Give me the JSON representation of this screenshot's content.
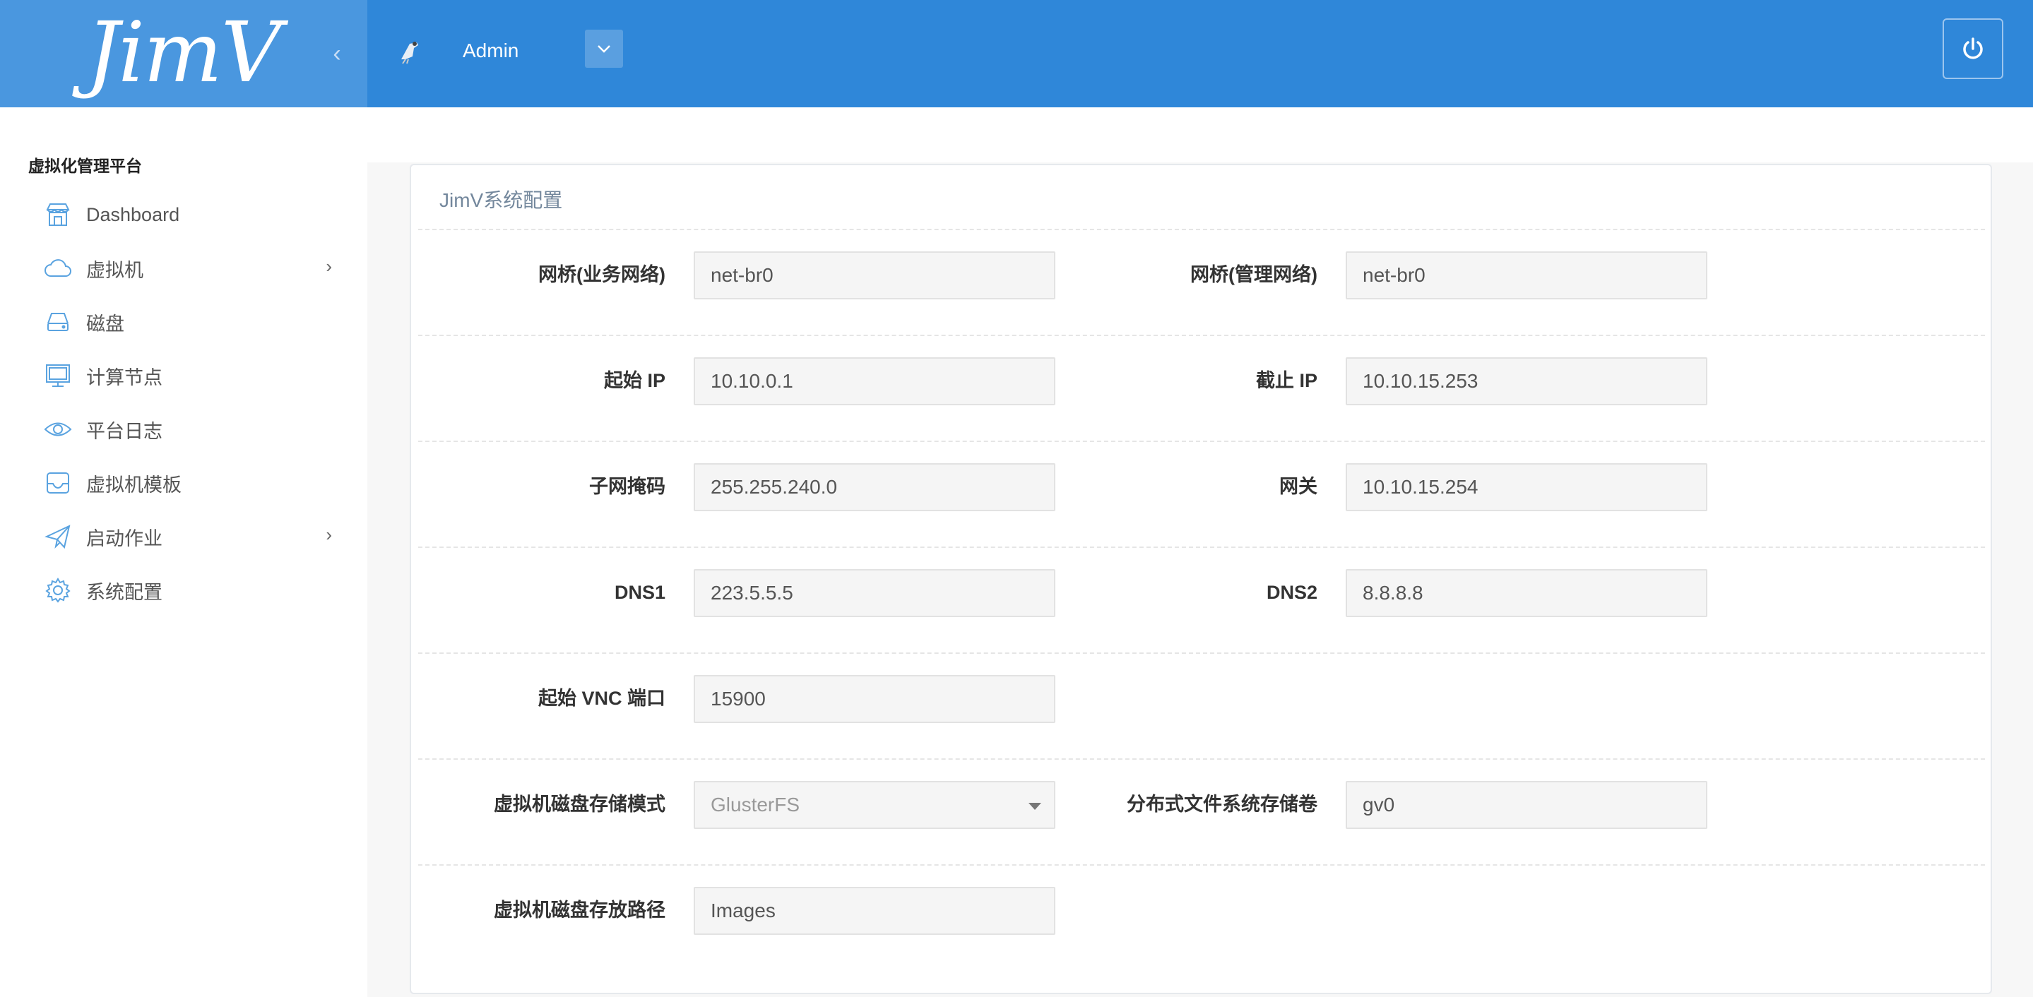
{
  "header": {
    "logo_text": "JimV",
    "user_name": "Admin",
    "collapse_icon": "chevron-left-icon",
    "dropdown_icon": "chevron-down-icon",
    "power_icon": "power-icon"
  },
  "sidebar": {
    "section_title": "虚拟化管理平台",
    "items": [
      {
        "label": "Dashboard",
        "icon": "store-icon",
        "has_children": false
      },
      {
        "label": "虚拟机",
        "icon": "cloud-icon",
        "has_children": true
      },
      {
        "label": "磁盘",
        "icon": "hdd-icon",
        "has_children": false
      },
      {
        "label": "计算节点",
        "icon": "desktop-icon",
        "has_children": false
      },
      {
        "label": "平台日志",
        "icon": "eye-icon",
        "has_children": false
      },
      {
        "label": "虚拟机模板",
        "icon": "inbox-icon",
        "has_children": false
      },
      {
        "label": "启动作业",
        "icon": "paper-plane-icon",
        "has_children": true
      },
      {
        "label": "系统配置",
        "icon": "gear-icon",
        "has_children": false
      }
    ]
  },
  "panel": {
    "title": "JimV系统配置",
    "fields": {
      "bridge_business": {
        "label": "网桥(业务网络)",
        "value": "net-br0"
      },
      "bridge_management": {
        "label": "网桥(管理网络)",
        "value": "net-br0"
      },
      "start_ip": {
        "label": "起始 IP",
        "value": "10.10.0.1"
      },
      "end_ip": {
        "label": "截止 IP",
        "value": "10.10.15.253"
      },
      "netmask": {
        "label": "子网掩码",
        "value": "255.255.240.0"
      },
      "gateway": {
        "label": "网关",
        "value": "10.10.15.254"
      },
      "dns1": {
        "label": "DNS1",
        "value": "223.5.5.5"
      },
      "dns2": {
        "label": "DNS2",
        "value": "8.8.8.8"
      },
      "vnc_port": {
        "label": "起始 VNC 端口",
        "value": "15900"
      },
      "storage_mode": {
        "label": "虚拟机磁盘存储模式",
        "value": "GlusterFS"
      },
      "dfs_volume": {
        "label": "分布式文件系统存储卷",
        "value": "gv0"
      },
      "storage_path": {
        "label": "虚拟机磁盘存放路径",
        "value": "Images"
      }
    }
  },
  "colors": {
    "header": "#2f87d9",
    "logo_area": "#4a97df",
    "icon_blue": "#5aa3e0"
  }
}
